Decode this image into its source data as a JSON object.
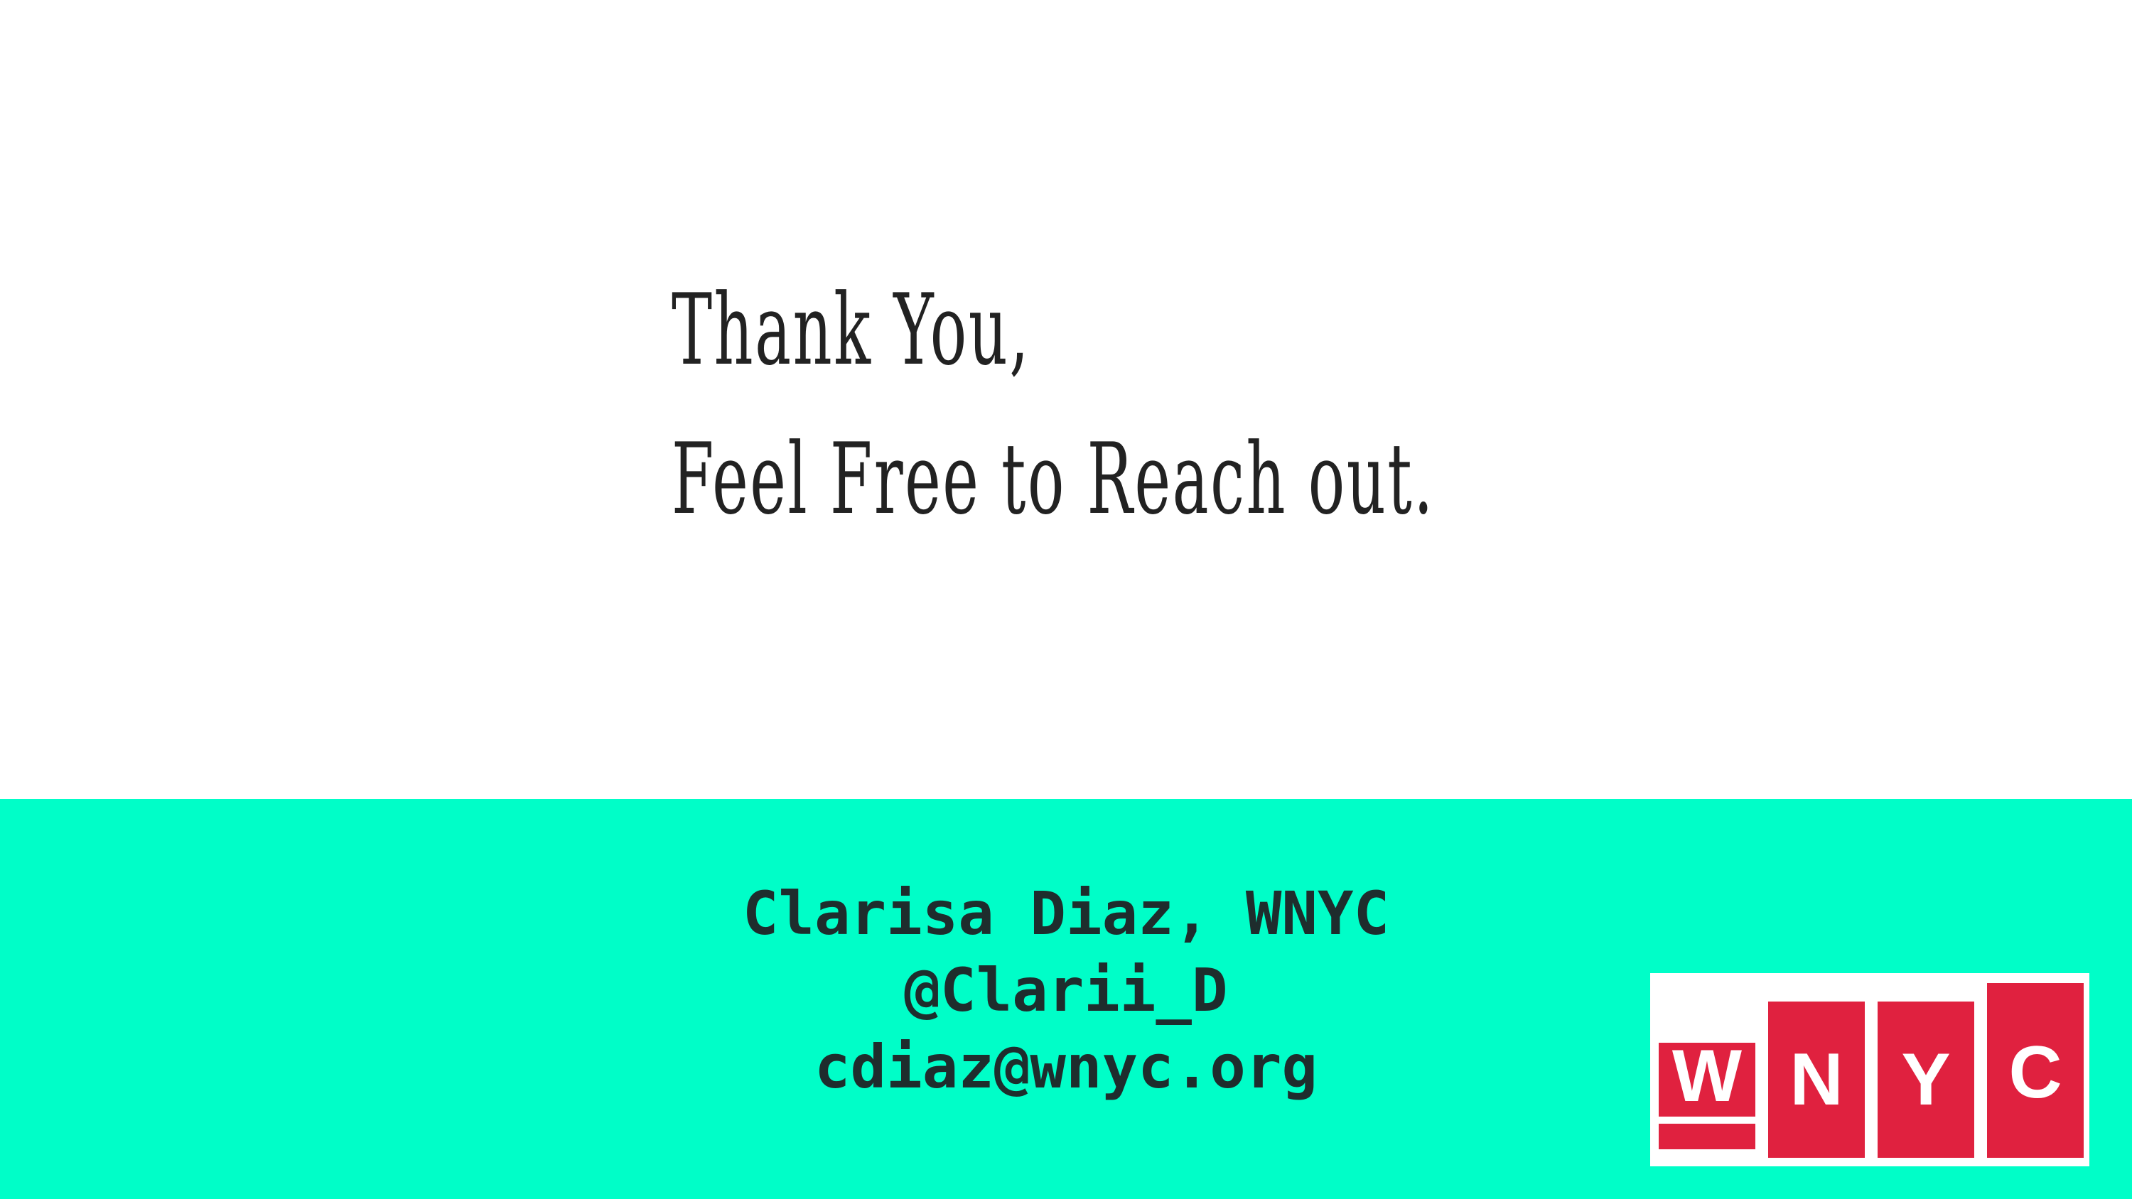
{
  "headline": {
    "line1": "Thank You,",
    "line2": "Feel Free to Reach out."
  },
  "contact": {
    "name": "Clarisa Diaz, WNYC",
    "handle": "@Clarii_D",
    "email": "cdiaz@wnyc.org"
  },
  "logo": {
    "letters": [
      "W",
      "N",
      "Y",
      "C"
    ],
    "color": "#e0213f"
  },
  "colors": {
    "band": "#00fec8",
    "headline_text": "#222222",
    "contact_text": "#1e2d2d"
  }
}
